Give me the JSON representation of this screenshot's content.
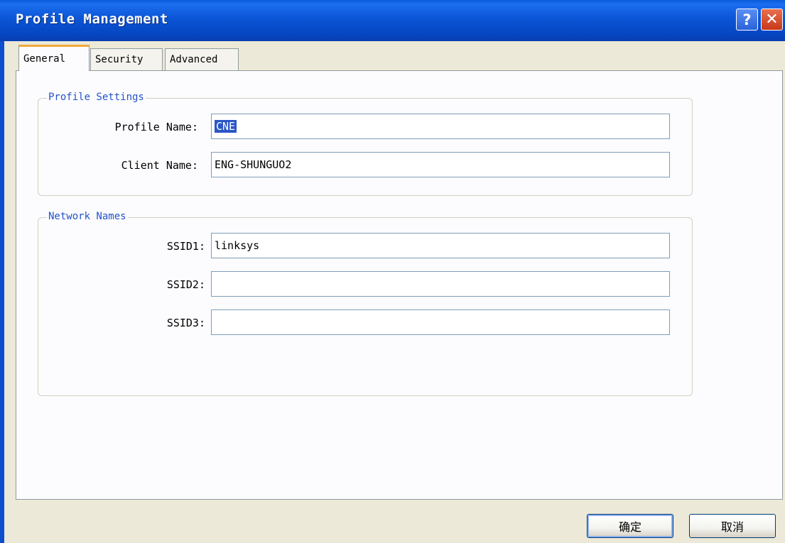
{
  "window": {
    "title": "Profile Management"
  },
  "tabs": [
    {
      "label": "General"
    },
    {
      "label": "Security"
    },
    {
      "label": "Advanced"
    }
  ],
  "profile_settings": {
    "legend": "Profile Settings",
    "profile_name_label": "Profile Name:",
    "profile_name_value": "CNE",
    "client_name_label": "Client Name:",
    "client_name_value": "ENG-SHUNGUO2"
  },
  "network_names": {
    "legend": "Network Names",
    "ssid1_label": "SSID1:",
    "ssid1_value": "linksys",
    "ssid2_label": "SSID2:",
    "ssid2_value": "",
    "ssid3_label": "SSID3:",
    "ssid3_value": ""
  },
  "buttons": {
    "ok": "确定",
    "cancel": "取消"
  },
  "icons": {
    "help": "help-icon",
    "close": "close-icon"
  },
  "colors": {
    "title_bar": "#0b55d6",
    "legend_text": "#2353c9",
    "active_tab_accent": "#f2a93b"
  }
}
